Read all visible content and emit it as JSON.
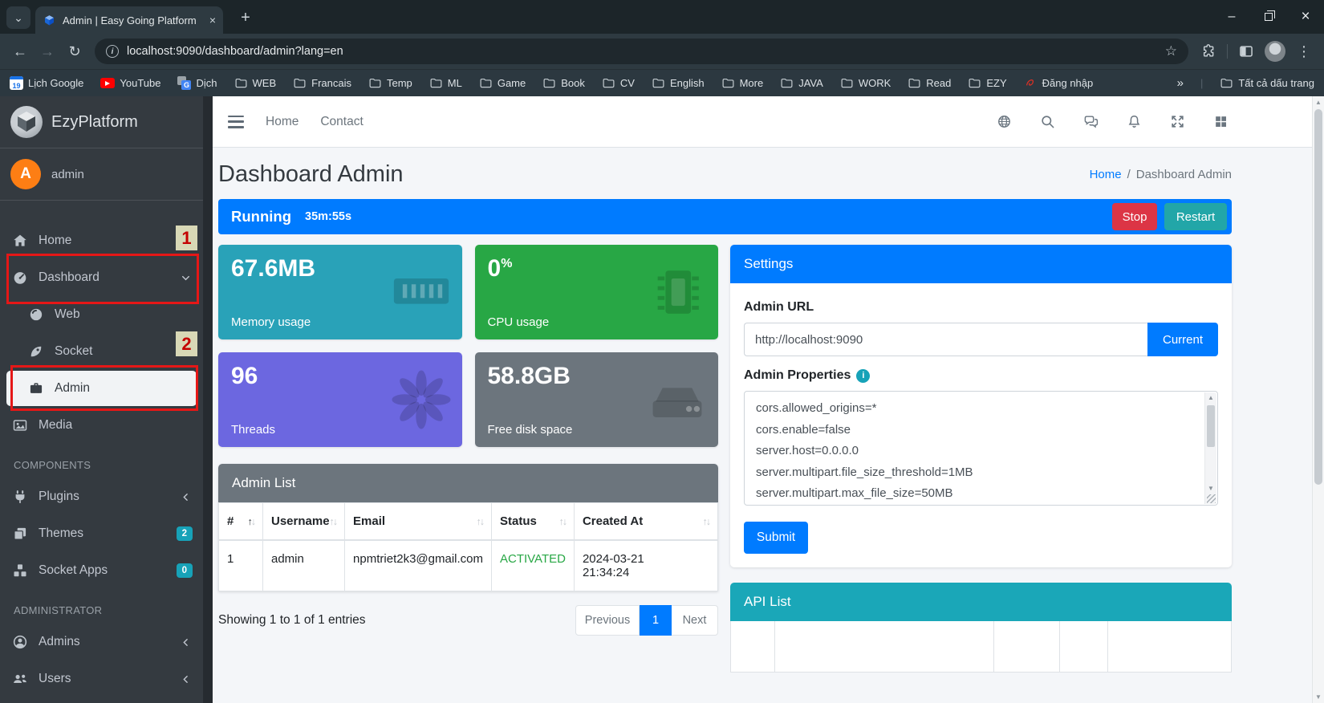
{
  "glyphs": {
    "chev_down": "⌄",
    "x": "×",
    "plus": "+",
    "minimize": "–",
    "back": "←",
    "forward": "→",
    "reload": "↻",
    "star": "☆",
    "kebab": "⋮",
    "overflow": "»",
    "up": "▲",
    "down": "▼",
    "info_i": "i",
    "sort_up": "↑",
    "sort_down": "↓",
    "gt_letter": "G",
    "cal_num": "19"
  },
  "browser": {
    "tab_title": "Admin | Easy Going Platform",
    "url": "localhost:9090/dashboard/admin?lang=en",
    "bookmarks": [
      {
        "label": "Lịch Google"
      },
      {
        "label": "YouTube"
      },
      {
        "label": "Dịch"
      },
      {
        "label": "WEB"
      },
      {
        "label": "Francais"
      },
      {
        "label": "Temp"
      },
      {
        "label": "ML"
      },
      {
        "label": "Game"
      },
      {
        "label": "Book"
      },
      {
        "label": "CV"
      },
      {
        "label": "English"
      },
      {
        "label": "More"
      },
      {
        "label": "JAVA"
      },
      {
        "label": "WORK"
      },
      {
        "label": "Read"
      },
      {
        "label": "EZY"
      },
      {
        "label": "Đăng nhập"
      }
    ],
    "all_bookmarks_label": "Tất cả dấu trang"
  },
  "sidebar": {
    "brand": "EzyPlatform",
    "user_initial": "A",
    "user_name": "admin",
    "items": {
      "home": "Home",
      "dashboard": "Dashboard",
      "web": "Web",
      "socket": "Socket",
      "admin": "Admin",
      "media": "Media",
      "plugins": "Plugins",
      "themes": "Themes",
      "socket_apps": "Socket Apps",
      "admins": "Admins",
      "users": "Users"
    },
    "section_components": "COMPONENTS",
    "section_administrator": "ADMINISTRATOR",
    "themes_badge": "2",
    "socket_apps_badge": "0"
  },
  "annotations": {
    "mark_home": "1",
    "mark_socket": "2"
  },
  "topnav": {
    "home": "Home",
    "contact": "Contact"
  },
  "page": {
    "title": "Dashboard Admin",
    "breadcrumb_home": "Home",
    "breadcrumb_sep": "/",
    "breadcrumb_current": "Dashboard Admin"
  },
  "runbar": {
    "status": "Running",
    "uptime": "35m:55s",
    "stop": "Stop",
    "restart": "Restart"
  },
  "stats": [
    {
      "value": "67.6MB",
      "label": "Memory usage",
      "color": "#29a2b8"
    },
    {
      "value": "0",
      "suffix": "%",
      "label": "CPU usage",
      "color": "#28a745"
    },
    {
      "value": "96",
      "label": "Threads",
      "color": "#6c67e0"
    },
    {
      "value": "58.8GB",
      "label": "Free disk space",
      "color": "#6c757d"
    }
  ],
  "admin_list": {
    "title": "Admin List",
    "columns": [
      "#",
      "Username",
      "Email",
      "Status",
      "Created At"
    ],
    "row": {
      "index": "1",
      "username": "admin",
      "email": "npmtriet2k3@gmail.com",
      "status": "ACTIVATED",
      "created_date": "2024-03-21",
      "created_time": "21:34:24"
    },
    "status_color": "#28a745",
    "summary": "Showing 1 to 1 of 1 entries",
    "prev": "Previous",
    "page": "1",
    "next": "Next"
  },
  "settings": {
    "title": "Settings",
    "admin_url_label": "Admin URL",
    "admin_url_value": "http://localhost:9090",
    "current_button": "Current",
    "properties_label": "Admin Properties",
    "properties": [
      "cors.allowed_origins=*",
      "cors.enable=false",
      "server.host=0.0.0.0",
      "server.multipart.file_size_threshold=1MB",
      "server.multipart.max_file_size=50MB"
    ],
    "submit_button": "Submit"
  },
  "api_list": {
    "title": "API List"
  },
  "colors": {
    "primary": "#007bff",
    "danger": "#dc3545",
    "restart_teal": "#22a6a8",
    "info": "#17a2b8",
    "secondary": "#6c757d",
    "success": "#28a745",
    "purple": "#6c67e0",
    "sidebar": "#343a40",
    "annotation_red": "#e51717",
    "annotation_badge_bg": "#d8d8b6"
  }
}
